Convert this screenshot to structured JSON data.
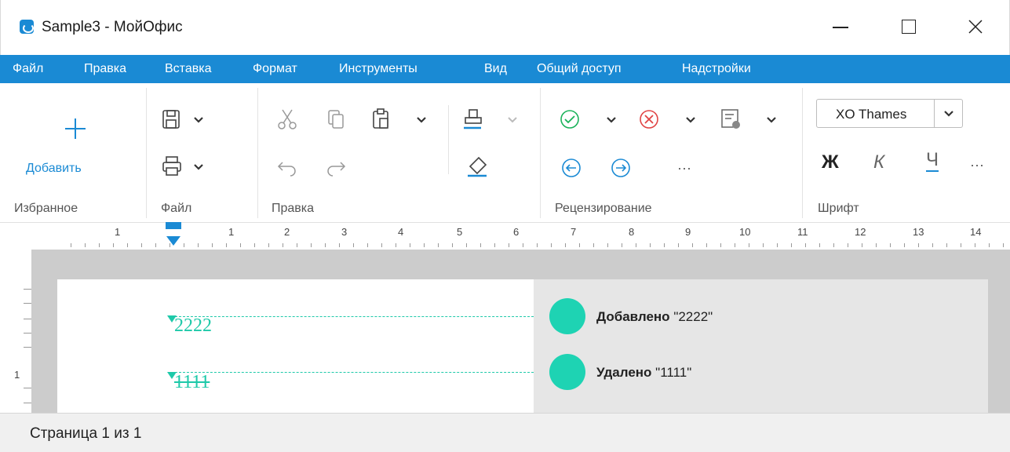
{
  "window": {
    "title": "Sample3 - МойОфис",
    "logo_icon": "myoffice-logo-icon",
    "min_icon": "minimize-icon",
    "max_icon": "maximize-icon",
    "close_icon": "close-icon",
    "close_glyph": "✕"
  },
  "menu": {
    "items": [
      "Файл",
      "Правка",
      "Вставка",
      "Формат",
      "Инструменты",
      "Вид",
      "Общий доступ",
      "Надстройки"
    ]
  },
  "ribbon": {
    "add_label": "Добавить",
    "groups": {
      "favorites": "Избранное",
      "file": "Файл",
      "edit": "Правка",
      "review": "Рецензирование",
      "font": "Шрифт"
    },
    "font_name": "XO Thames",
    "bold_glyph": "Ж",
    "italic_glyph": "К",
    "underline_glyph": "Ч",
    "more_glyph": "···"
  },
  "ruler": {
    "numbers": [
      "1",
      "1",
      "2",
      "3",
      "4",
      "5",
      "6",
      "7",
      "8",
      "9",
      "10",
      "11",
      "12",
      "13",
      "14"
    ],
    "vertical_number": "1"
  },
  "document": {
    "inserted_text": "2222",
    "deleted_text": "1111"
  },
  "review": {
    "changes": [
      {
        "action": "Добавлено",
        "text": "\"2222\""
      },
      {
        "action": "Удалено",
        "text": "\"1111\""
      }
    ],
    "accent_color": "#1ed3b3"
  },
  "status": {
    "page_info": "Страница 1 из 1"
  },
  "colors": {
    "menu_bg": "#1a8ad4",
    "change_color": "#1ec9a9"
  }
}
